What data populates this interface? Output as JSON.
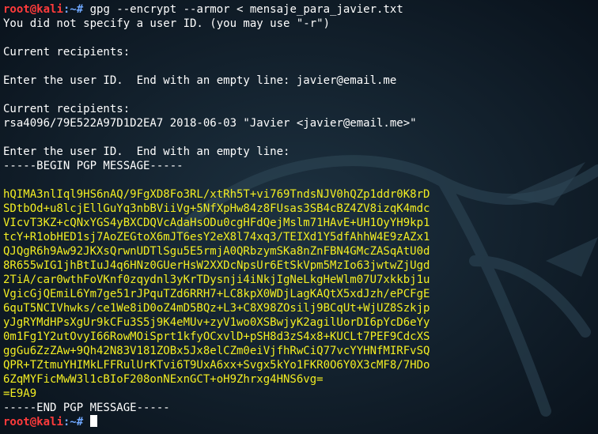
{
  "terminal": {
    "prompt": {
      "user": "root",
      "at": "@",
      "host": "kali",
      "path": ":~# "
    },
    "command": "gpg --encrypt --armor < mensaje_para_javier.txt",
    "output_before": [
      "You did not specify a user ID. (you may use \"-r\")",
      "",
      "Current recipients:",
      "",
      "Enter the user ID.  End with an empty line: javier@email.me",
      "",
      "Current recipients:",
      "rsa4096/79E522A97D1D2EA7 2018-06-03 \"Javier <javier@email.me>\"",
      "",
      "Enter the user ID.  End with an empty line:",
      "-----BEGIN PGP MESSAGE-----",
      ""
    ],
    "pgp_lines": [
      "hQIMA3nlIql9HS6nAQ/9FgXD8Fo3RL/xtRh5T+vi769TndsNJV0hQZp1ddr0K8rD",
      "SDtbOd+u8lcjEllGuYq3nbBViiVg+5NfXpHw84z8FUsas3SB4cBZ4ZV8izqK4mdc",
      "VIcvT3KZ+cQNxYGS4yBXCDQVcAdaHsODu0cgHFdQejMslm71HAvE+UH1OyYH9kp1",
      "tcY+R1obHED1sj7AoZEGtoX6mJT6esY2eX8l74xq3/TEIXd1Y5dfAhhW4E9zAZx1",
      "QJQgR6h9Aw92JKXsQrwnUDTlSgu5E5rmjA0QRbzymSKa8nZnFBN4GMcZASqAtU0d",
      "8R655wIG1jhBtIuJ4q6HNz0GUerHsW2XXDcNpsUr6EtSkVpm5MzIo63jwtwZjUgd",
      "2TiA/car0wthFoVKnf0zqydnl3yKrTDysnji4iNkjIgNeLkgHeWlm07U7xkkbj1u",
      "VgicGjQEmiL6Ym7ge51rJPquTZd6RRH7+LC8kpX0WDjLagKAQtX5xdJzh/ePCFgE",
      "6quT5NCIVhwks/ce1We8iD0oZ4mD5BQz+L3+C8X98ZOsilj9BCqUt+WjUZ8Szkjp",
      "yJgRYMdHPsXgUr9kCFu3S5j9K4eMUv+zyV1wo0XSBwjyK2agilUorDI6pYcD6eYy",
      "0m1Fg1Y2utOvyI66RowMOiSprt1kfyOCxvlD+pSH8d3zS4x8+KUCLt7PEF9CdcXS",
      "ggGu6ZzZAw+9Qh42N83V181ZOBx5Jx8elCZm0eiVjfhRwCiQ77vcYYHNfMIRFvSQ",
      "QPR+TZtmuYHIMkLFFRulUrKTvi6T9UxA6xx+Svgx5kYo1FKR0O6Y0X3cMF8/7HDo",
      "6ZqMYFicMwW3l1cBIoF208onNExnGCT+oH9Zhrxg4HNS6vg=",
      "=E9A9"
    ],
    "output_after": [
      "-----END PGP MESSAGE-----"
    ]
  }
}
